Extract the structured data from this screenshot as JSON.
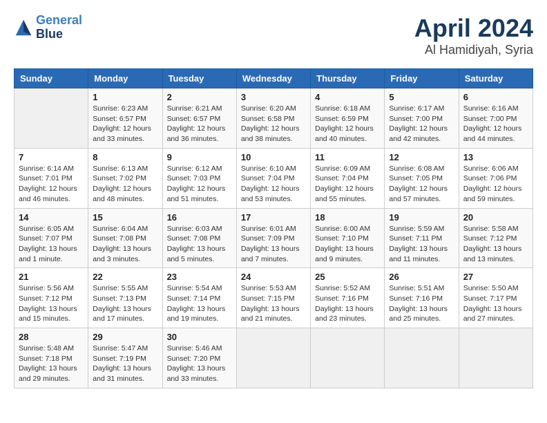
{
  "header": {
    "logo_line1": "General",
    "logo_line2": "Blue",
    "month": "April 2024",
    "location": "Al Hamidiyah, Syria"
  },
  "weekdays": [
    "Sunday",
    "Monday",
    "Tuesday",
    "Wednesday",
    "Thursday",
    "Friday",
    "Saturday"
  ],
  "weeks": [
    [
      {
        "num": "",
        "info": ""
      },
      {
        "num": "1",
        "info": "Sunrise: 6:23 AM\nSunset: 6:57 PM\nDaylight: 12 hours\nand 33 minutes."
      },
      {
        "num": "2",
        "info": "Sunrise: 6:21 AM\nSunset: 6:57 PM\nDaylight: 12 hours\nand 36 minutes."
      },
      {
        "num": "3",
        "info": "Sunrise: 6:20 AM\nSunset: 6:58 PM\nDaylight: 12 hours\nand 38 minutes."
      },
      {
        "num": "4",
        "info": "Sunrise: 6:18 AM\nSunset: 6:59 PM\nDaylight: 12 hours\nand 40 minutes."
      },
      {
        "num": "5",
        "info": "Sunrise: 6:17 AM\nSunset: 7:00 PM\nDaylight: 12 hours\nand 42 minutes."
      },
      {
        "num": "6",
        "info": "Sunrise: 6:16 AM\nSunset: 7:00 PM\nDaylight: 12 hours\nand 44 minutes."
      }
    ],
    [
      {
        "num": "7",
        "info": "Sunrise: 6:14 AM\nSunset: 7:01 PM\nDaylight: 12 hours\nand 46 minutes."
      },
      {
        "num": "8",
        "info": "Sunrise: 6:13 AM\nSunset: 7:02 PM\nDaylight: 12 hours\nand 48 minutes."
      },
      {
        "num": "9",
        "info": "Sunrise: 6:12 AM\nSunset: 7:03 PM\nDaylight: 12 hours\nand 51 minutes."
      },
      {
        "num": "10",
        "info": "Sunrise: 6:10 AM\nSunset: 7:04 PM\nDaylight: 12 hours\nand 53 minutes."
      },
      {
        "num": "11",
        "info": "Sunrise: 6:09 AM\nSunset: 7:04 PM\nDaylight: 12 hours\nand 55 minutes."
      },
      {
        "num": "12",
        "info": "Sunrise: 6:08 AM\nSunset: 7:05 PM\nDaylight: 12 hours\nand 57 minutes."
      },
      {
        "num": "13",
        "info": "Sunrise: 6:06 AM\nSunset: 7:06 PM\nDaylight: 12 hours\nand 59 minutes."
      }
    ],
    [
      {
        "num": "14",
        "info": "Sunrise: 6:05 AM\nSunset: 7:07 PM\nDaylight: 13 hours\nand 1 minute."
      },
      {
        "num": "15",
        "info": "Sunrise: 6:04 AM\nSunset: 7:08 PM\nDaylight: 13 hours\nand 3 minutes."
      },
      {
        "num": "16",
        "info": "Sunrise: 6:03 AM\nSunset: 7:08 PM\nDaylight: 13 hours\nand 5 minutes."
      },
      {
        "num": "17",
        "info": "Sunrise: 6:01 AM\nSunset: 7:09 PM\nDaylight: 13 hours\nand 7 minutes."
      },
      {
        "num": "18",
        "info": "Sunrise: 6:00 AM\nSunset: 7:10 PM\nDaylight: 13 hours\nand 9 minutes."
      },
      {
        "num": "19",
        "info": "Sunrise: 5:59 AM\nSunset: 7:11 PM\nDaylight: 13 hours\nand 11 minutes."
      },
      {
        "num": "20",
        "info": "Sunrise: 5:58 AM\nSunset: 7:12 PM\nDaylight: 13 hours\nand 13 minutes."
      }
    ],
    [
      {
        "num": "21",
        "info": "Sunrise: 5:56 AM\nSunset: 7:12 PM\nDaylight: 13 hours\nand 15 minutes."
      },
      {
        "num": "22",
        "info": "Sunrise: 5:55 AM\nSunset: 7:13 PM\nDaylight: 13 hours\nand 17 minutes."
      },
      {
        "num": "23",
        "info": "Sunrise: 5:54 AM\nSunset: 7:14 PM\nDaylight: 13 hours\nand 19 minutes."
      },
      {
        "num": "24",
        "info": "Sunrise: 5:53 AM\nSunset: 7:15 PM\nDaylight: 13 hours\nand 21 minutes."
      },
      {
        "num": "25",
        "info": "Sunrise: 5:52 AM\nSunset: 7:16 PM\nDaylight: 13 hours\nand 23 minutes."
      },
      {
        "num": "26",
        "info": "Sunrise: 5:51 AM\nSunset: 7:16 PM\nDaylight: 13 hours\nand 25 minutes."
      },
      {
        "num": "27",
        "info": "Sunrise: 5:50 AM\nSunset: 7:17 PM\nDaylight: 13 hours\nand 27 minutes."
      }
    ],
    [
      {
        "num": "28",
        "info": "Sunrise: 5:48 AM\nSunset: 7:18 PM\nDaylight: 13 hours\nand 29 minutes."
      },
      {
        "num": "29",
        "info": "Sunrise: 5:47 AM\nSunset: 7:19 PM\nDaylight: 13 hours\nand 31 minutes."
      },
      {
        "num": "30",
        "info": "Sunrise: 5:46 AM\nSunset: 7:20 PM\nDaylight: 13 hours\nand 33 minutes."
      },
      {
        "num": "",
        "info": ""
      },
      {
        "num": "",
        "info": ""
      },
      {
        "num": "",
        "info": ""
      },
      {
        "num": "",
        "info": ""
      }
    ]
  ]
}
